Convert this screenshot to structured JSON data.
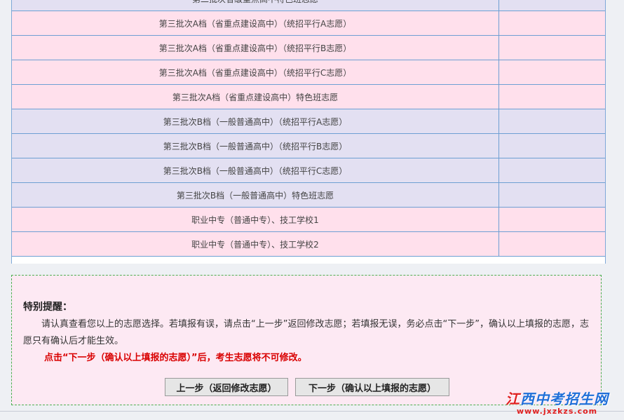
{
  "table": {
    "rows": [
      {
        "label": "第二批次省级重点高中特色班志愿",
        "color": "lav"
      },
      {
        "label": "第三批次A档（省重点建设高中）（统招平行A志愿）",
        "color": "pink"
      },
      {
        "label": "第三批次A档（省重点建设高中）（统招平行B志愿）",
        "color": "pink"
      },
      {
        "label": "第三批次A档（省重点建设高中）（统招平行C志愿）",
        "color": "pink"
      },
      {
        "label": "第三批次A档（省重点建设高中）特色班志愿",
        "color": "pink"
      },
      {
        "label": "第三批次B档（一般普通高中）（统招平行A志愿）",
        "color": "lav"
      },
      {
        "label": "第三批次B档（一般普通高中）（统招平行B志愿）",
        "color": "lav"
      },
      {
        "label": "第三批次B档（一般普通高中）（统招平行C志愿）",
        "color": "lav"
      },
      {
        "label": "第三批次B档（一般普通高中）特色班志愿",
        "color": "lav"
      },
      {
        "label": "职业中专（普通中专）、技工学校1",
        "color": "pink"
      },
      {
        "label": "职业中专（普通中专）、技工学校2",
        "color": "pink"
      }
    ]
  },
  "notice": {
    "title": "特别提醒：",
    "paragraph": "请认真查看您以上的志愿选择。若填报有误，请点击“上一步”返回修改志愿；若填报无误，务必点击“下一步”，确认以上填报的志愿，志愿只有确认后才能生效。",
    "warning": "点击“下一步（确认以上填报的志愿）”后，考生志愿将不可修改。"
  },
  "buttons": {
    "prev_label": "上一步（返回修改志愿）",
    "next_label": "下一步（确认以上填报的志愿）"
  },
  "watermark": {
    "first_char": "江",
    "rest": "西中考招生网",
    "url": "www.jxzkzs.com"
  }
}
